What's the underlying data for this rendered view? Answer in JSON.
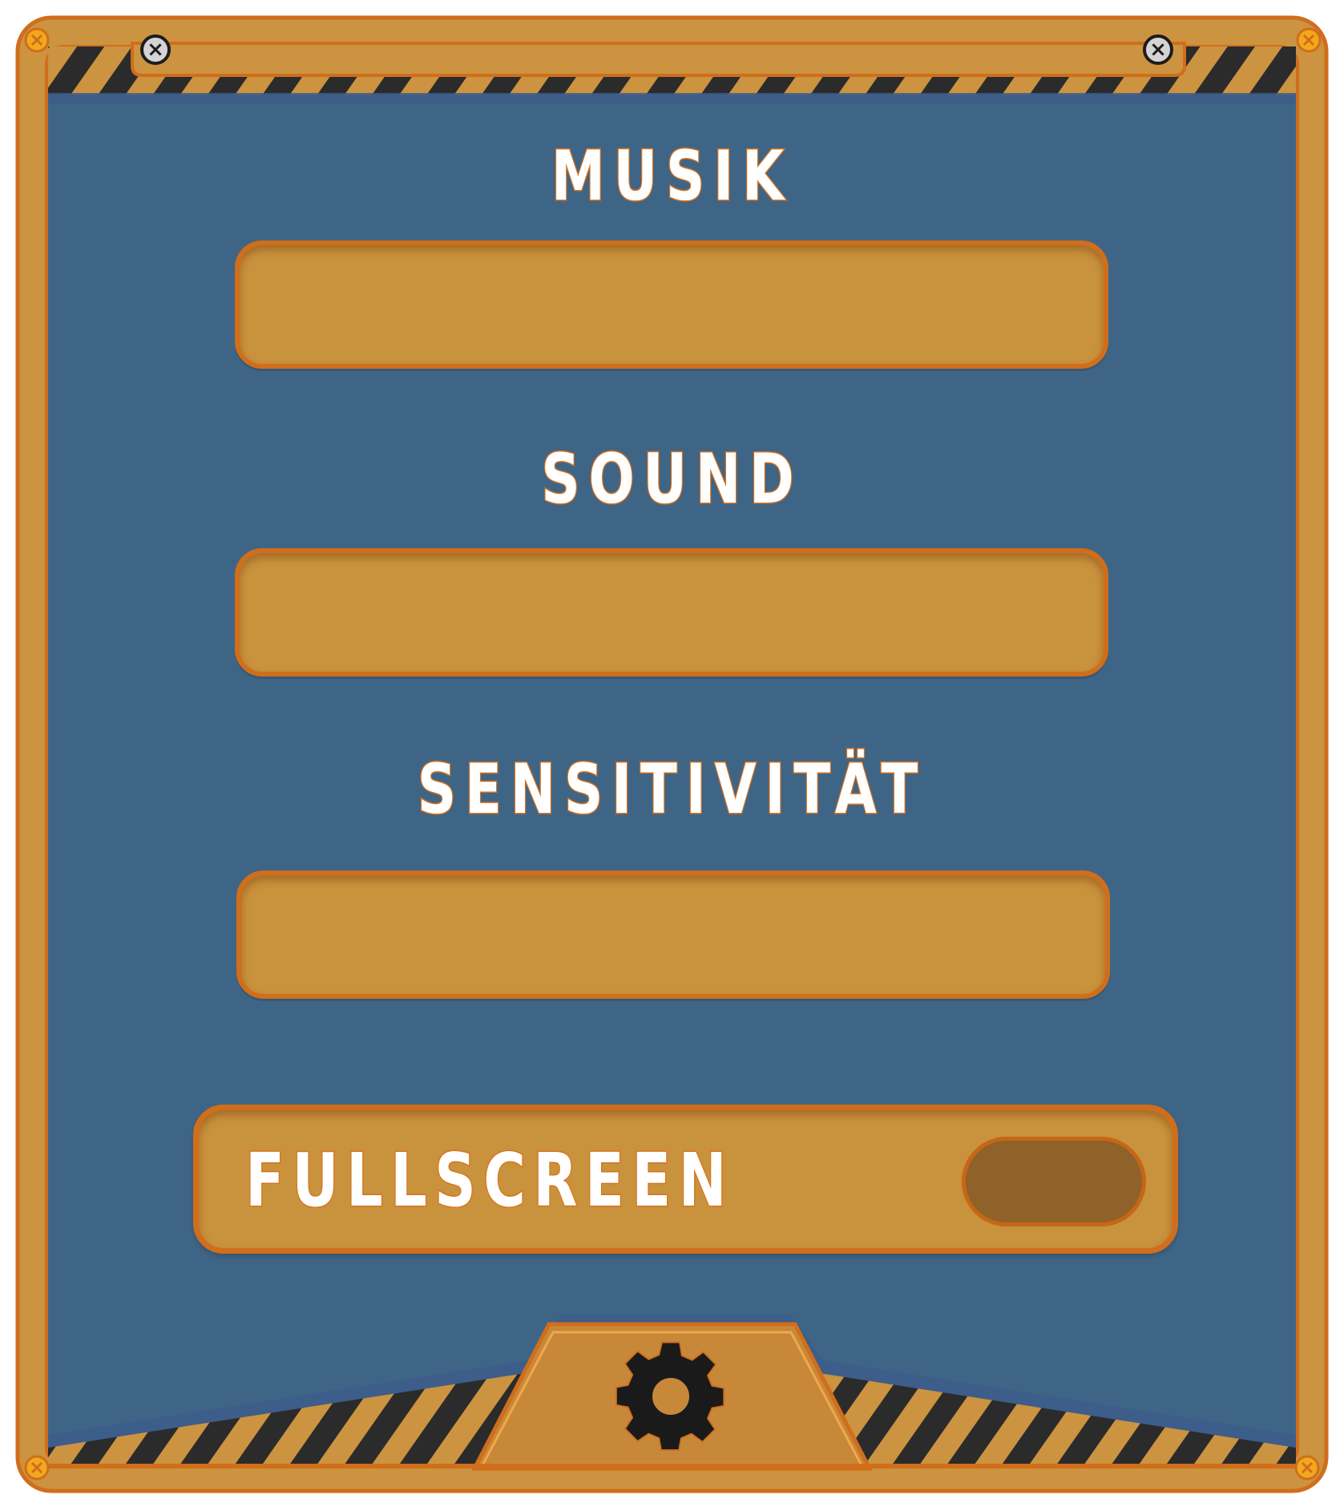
{
  "settings": {
    "music_label": "MUSIK",
    "sound_label": "SOUND",
    "sensitivity_label": "SENSITIVITÄT",
    "fullscreen_label": "FULLSCREEN"
  },
  "icons": {
    "close_left": "close-icon",
    "close_right": "close-icon",
    "settings": "gear-icon",
    "corner": "bolt-icon"
  },
  "colors": {
    "frame": "#cc9340",
    "frame_edge": "#d06e1b",
    "panel_bg": "#3f6586",
    "stripe_dark": "#2b2b2b",
    "text": "#ffffff",
    "text_outline": "#d9731e",
    "toggle_off": "#8e6229"
  }
}
